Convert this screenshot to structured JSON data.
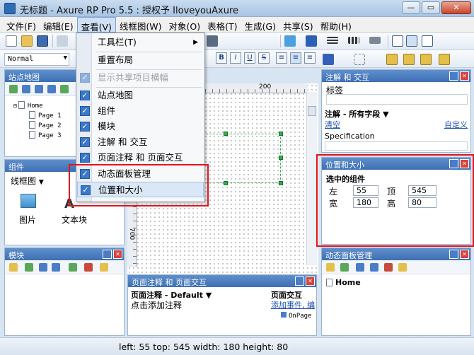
{
  "window": {
    "title": "无标题 - Axure RP Pro 5.5 : 授权予 IloveyouAxure",
    "min": "—",
    "max": "▭",
    "close": "✕"
  },
  "menubar": [
    "文件(F)",
    "编辑(E)",
    "查看(V)",
    "线框图(W)",
    "对象(O)",
    "表格(T)",
    "生成(G)",
    "共享(S)",
    "帮助(H)"
  ],
  "toolbar": {
    "font_name": "Normal",
    "bold": "B",
    "italic": "I",
    "underline": "U",
    "strike": "S"
  },
  "view_menu": {
    "items": [
      {
        "label": "工具栏(T)",
        "checked": false,
        "disabled": false,
        "submenu": true
      },
      {
        "label": "重置布局",
        "checked": false,
        "disabled": false
      },
      {
        "label": "显示共享项目横幅",
        "checked": true,
        "disabled": true
      },
      {
        "label": "站点地图",
        "checked": true,
        "disabled": false
      },
      {
        "label": "组件",
        "checked": true,
        "disabled": false
      },
      {
        "label": "模块",
        "checked": true,
        "disabled": false
      },
      {
        "label": "注解 和 交互",
        "checked": true,
        "disabled": false
      },
      {
        "label": "页面注释 和 页面交互",
        "checked": true,
        "disabled": false
      },
      {
        "label": "动态面板管理",
        "checked": true,
        "disabled": false
      },
      {
        "label": "位置和大小",
        "checked": true,
        "disabled": false,
        "highlighted": true
      }
    ]
  },
  "sitemap": {
    "title": "站点地图",
    "nodes": [
      "Home",
      "Page 1",
      "Page 2",
      "Page 3"
    ]
  },
  "widgets": {
    "title": "组件",
    "library": "线框图",
    "items": [
      "图片",
      "文本块"
    ]
  },
  "masters": {
    "title": "模块"
  },
  "canvas": {
    "ruler_h": "200",
    "ruler_v": "700"
  },
  "page_notes": {
    "title": "页面注释 和 页面交互",
    "tab_notes": "页面注释 - Default",
    "placeholder": "点击添加注释",
    "tab_interactions": "页面交互",
    "add_event": "添加事件",
    "edit": "编",
    "on_page": "OnPage"
  },
  "annotations": {
    "title": "注解 和 交互",
    "label": "标签",
    "fields": "注解 - 所有字段",
    "clear": "清空",
    "custom": "自定义",
    "spec": "Specification"
  },
  "position_size": {
    "title": "位置和大小",
    "section": "选中的组件",
    "left_label": "左",
    "left": "55",
    "top_label": "顶",
    "top": "545",
    "width_label": "宽",
    "width": "180",
    "height_label": "高",
    "height": "80"
  },
  "dynamic_panels": {
    "title": "动态面板管理",
    "node": "Home"
  },
  "status": {
    "text": "left: 55   top: 545   width: 180   height: 80"
  },
  "colors": {
    "panel_header": "#4a7dc5",
    "highlight_red": "#e3141b",
    "check_blue": "#3a78c9"
  }
}
